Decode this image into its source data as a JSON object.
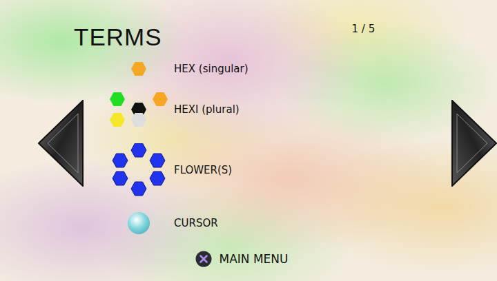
{
  "title": "TERMS",
  "page": "1 / 5",
  "terms": [
    {
      "kind": "hex",
      "label": "HEX (singular)",
      "color": "#f5a623"
    },
    {
      "kind": "hexi",
      "label": "HEXI (plural)",
      "hexes": [
        "#22dd22",
        "#111111",
        "#f5a623",
        "#f5e62a",
        "#dddddd"
      ]
    },
    {
      "kind": "flower",
      "label": "FLOWER(S)",
      "color": "#2233ee"
    },
    {
      "kind": "cursor",
      "label": "CURSOR",
      "color": "#7fd6dd"
    }
  ],
  "footer": {
    "label": "MAIN MENU"
  }
}
